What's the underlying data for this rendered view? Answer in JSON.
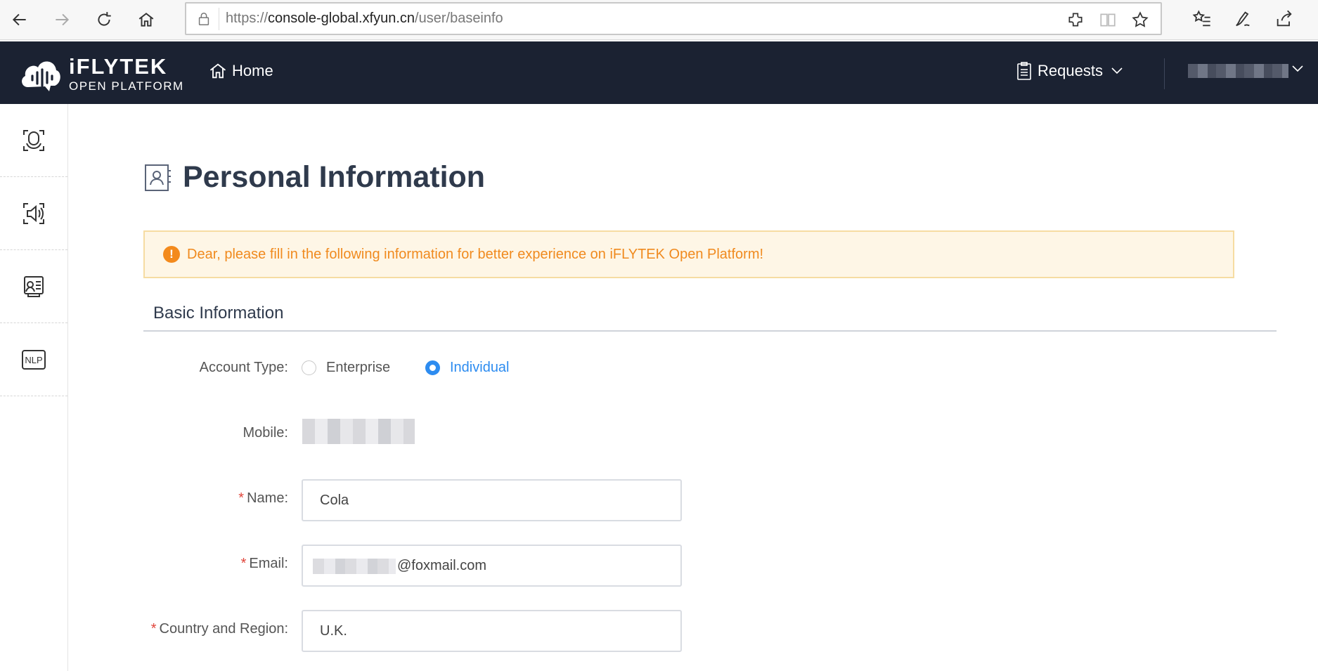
{
  "browser": {
    "url_prefix": "https://",
    "url_host": "console-global.xfyun.cn",
    "url_path": "/user/baseinfo",
    "icons": [
      "back-arrow-icon",
      "forward-arrow-icon",
      "refresh-icon",
      "home-icon",
      "lock-icon",
      "extension-icon",
      "reading-view-icon",
      "favorite-star-icon",
      "favorites-list-icon",
      "pen-icon",
      "share-icon"
    ]
  },
  "header": {
    "logo_brand": "iFLYTEK",
    "logo_sub": "OPEN PLATFORM",
    "home_label": "Home",
    "requests_label": "Requests",
    "bg_color": "#1b2232"
  },
  "sidebar": {
    "items": [
      {
        "name": "speech-recognition-icon"
      },
      {
        "name": "speech-synthesis-icon"
      },
      {
        "name": "voice-assistant-icon"
      },
      {
        "name": "nlp-icon",
        "label": "NLP"
      }
    ]
  },
  "main": {
    "page_title": "Personal Information",
    "alert_icon": "!",
    "alert_text": "Dear, please fill in the following information for better experience on iFLYTEK Open Platform!",
    "section_title": "Basic Information",
    "form": {
      "account_type_label": "Account Type:",
      "account_type_options": [
        "Enterprise",
        "Individual"
      ],
      "account_type_selected": "Individual",
      "mobile_label": "Mobile:",
      "required_mark": "*",
      "name_label": "Name:",
      "name_value": "Cola",
      "email_label": "Email:",
      "email_value": "@foxmail.com",
      "country_label": "Country and Region:",
      "country_value": "U.K."
    },
    "accent_color": "#2d8cf0",
    "alert_color": "#f08a1e"
  }
}
